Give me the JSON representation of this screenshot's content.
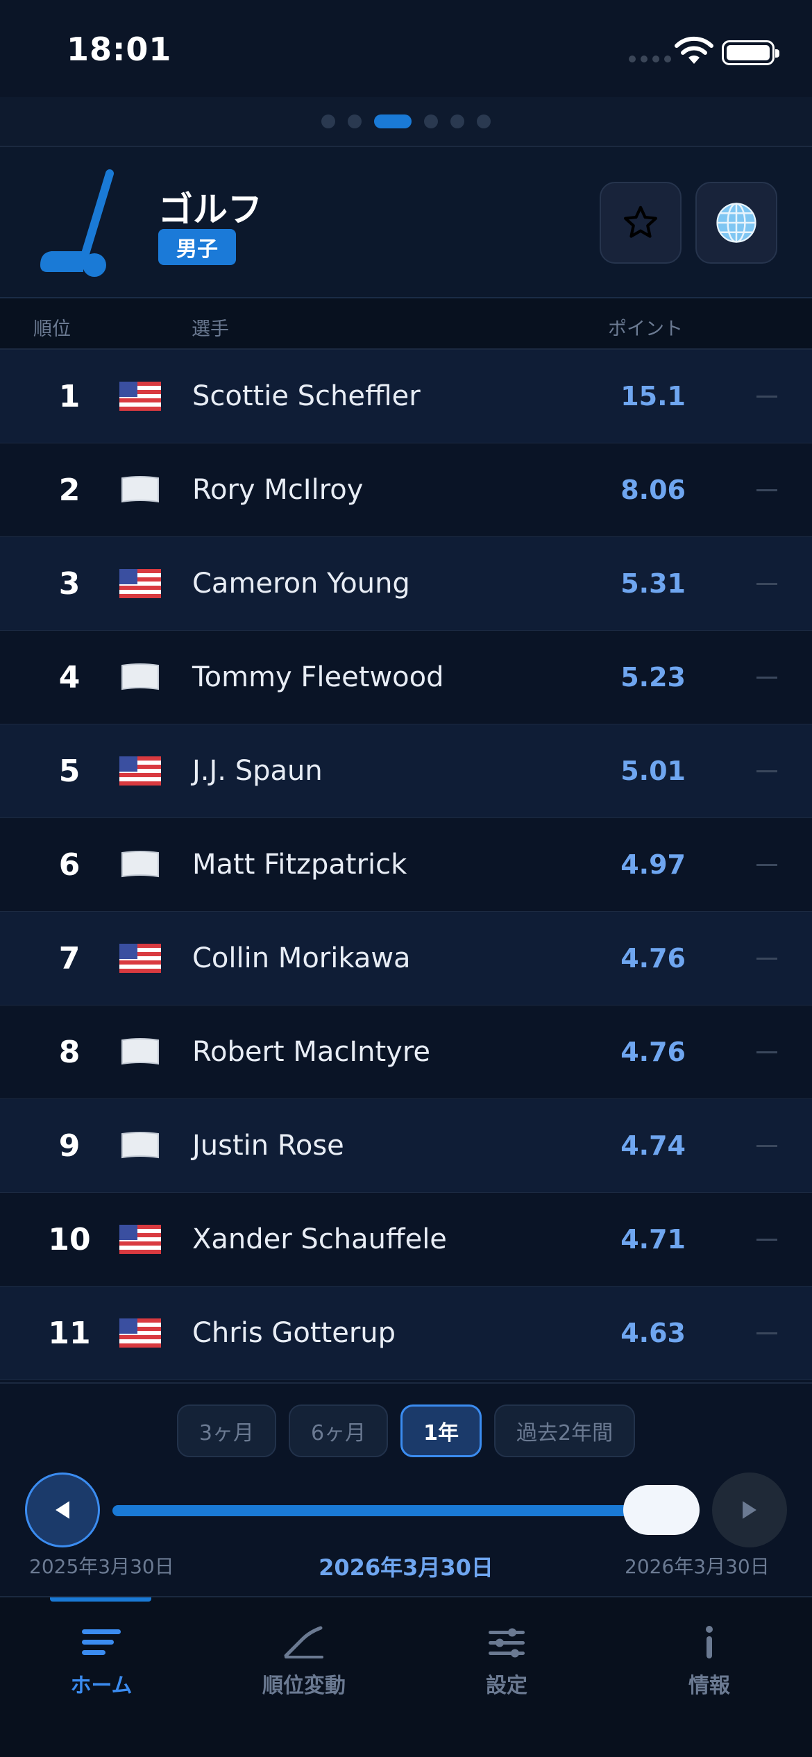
{
  "status": {
    "time": "18:01"
  },
  "header": {
    "sport": "ゴルフ",
    "category": "男子"
  },
  "columns": {
    "rank": "順位",
    "player": "選手",
    "points": "ポイント"
  },
  "rankings": [
    {
      "rank": "1",
      "name": "Scottie Scheffler",
      "points": "15.1",
      "flag": "us"
    },
    {
      "rank": "2",
      "name": "Rory McIlroy",
      "points": "8.06",
      "flag": "white"
    },
    {
      "rank": "3",
      "name": "Cameron Young",
      "points": "5.31",
      "flag": "us"
    },
    {
      "rank": "4",
      "name": "Tommy Fleetwood",
      "points": "5.23",
      "flag": "white"
    },
    {
      "rank": "5",
      "name": "J.J. Spaun",
      "points": "5.01",
      "flag": "us"
    },
    {
      "rank": "6",
      "name": "Matt Fitzpatrick",
      "points": "4.97",
      "flag": "white"
    },
    {
      "rank": "7",
      "name": "Collin Morikawa",
      "points": "4.76",
      "flag": "us"
    },
    {
      "rank": "8",
      "name": "Robert MacIntyre",
      "points": "4.76",
      "flag": "white"
    },
    {
      "rank": "9",
      "name": "Justin Rose",
      "points": "4.74",
      "flag": "white"
    },
    {
      "rank": "10",
      "name": "Xander Schauffele",
      "points": "4.71",
      "flag": "us"
    },
    {
      "rank": "11",
      "name": "Chris Gotterup",
      "points": "4.63",
      "flag": "us"
    }
  ],
  "ranges": [
    "3ヶ月",
    "6ヶ月",
    "1年",
    "過去2年間"
  ],
  "selected_range": "1年",
  "timeline": {
    "start_date": "2025年3月30日",
    "current_date": "2026年3月30日",
    "end_date": "2026年3月30日",
    "position": 1.0
  },
  "tabs": {
    "home": "ホーム",
    "rank_change": "順位変動",
    "settings": "設定",
    "info": "情報"
  },
  "colors": {
    "accent": "#1a7ad6",
    "points": "#6fa6f0",
    "background": "#0a1426"
  }
}
